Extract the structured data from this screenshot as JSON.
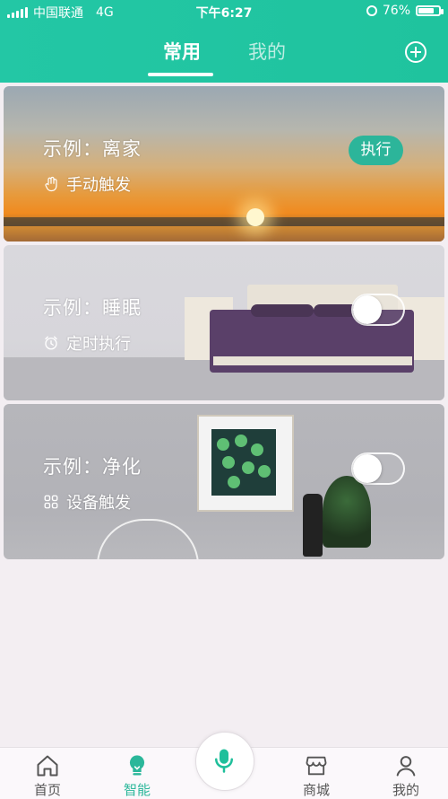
{
  "status_bar": {
    "carrier": "中国联通",
    "network": "4G",
    "time": "下午6:27",
    "battery": "76%",
    "battery_level": 0.76
  },
  "header": {
    "tabs": [
      {
        "label": "常用",
        "active": true
      },
      {
        "label": "我的",
        "active": false
      }
    ],
    "add_icon": "plus-circle-icon"
  },
  "scenes": [
    {
      "title": "示例：离家",
      "trigger": "手动触发",
      "trigger_icon": "hand-pointer-icon",
      "action": "执行"
    },
    {
      "title": "示例：睡眠",
      "trigger": "定时执行",
      "trigger_icon": "alarm-clock-icon",
      "toggle_on": false
    },
    {
      "title": "示例：净化",
      "trigger": "设备触发",
      "trigger_icon": "grid-icon",
      "toggle_on": false
    }
  ],
  "bottom_nav": [
    {
      "label": "首页",
      "icon": "home-icon"
    },
    {
      "label": "智能",
      "icon": "lightbulb-icon",
      "active": true
    },
    {
      "label": "",
      "icon": "microphone-icon"
    },
    {
      "label": "商城",
      "icon": "store-icon"
    },
    {
      "label": "我的",
      "icon": "user-icon"
    }
  ],
  "colors": {
    "accent": "#22c5a2",
    "active_nav": "#2bb79a"
  }
}
